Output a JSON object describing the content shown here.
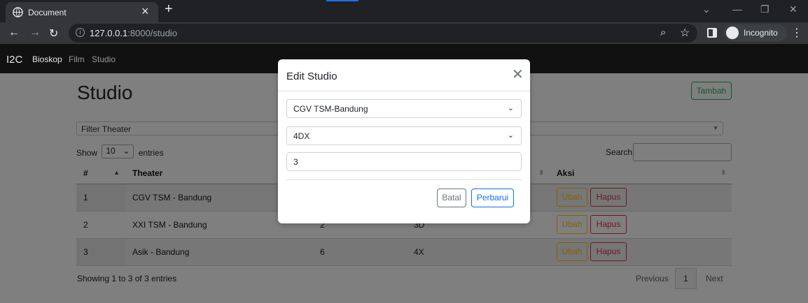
{
  "browser": {
    "tab_title": "Document",
    "url_host": "127.0.0.1",
    "url_path": ":8000/studio",
    "profile_label": "Incognito"
  },
  "navbar": {
    "brand": "I2C",
    "links": [
      {
        "label": "Bioskop",
        "active": true
      },
      {
        "label": "Film",
        "active": false
      },
      {
        "label": "Studio",
        "active": false
      }
    ]
  },
  "page": {
    "title": "Studio",
    "add_button": "Tambah",
    "filter_placeholder": "Filter Theater",
    "length_label_before": "Show",
    "length_value": "10",
    "length_label_after": "entries",
    "search_label": "Search:",
    "table": {
      "headers": [
        "#",
        "Theater",
        "",
        "",
        "Aksi"
      ],
      "rows": [
        {
          "no": "1",
          "theater": "CGV TSM - Bandung",
          "col3": "",
          "col4": ""
        },
        {
          "no": "2",
          "theater": "XXI TSM - Bandung",
          "col3": "2",
          "col4": "3D"
        },
        {
          "no": "3",
          "theater": "Asik - Bandung",
          "col3": "6",
          "col4": "4X"
        }
      ],
      "edit_label": "Ubah",
      "delete_label": "Hapus"
    },
    "info": "Showing 1 to 3 of 3 entries",
    "pagination": {
      "previous": "Previous",
      "current": "1",
      "next": "Next"
    }
  },
  "modal": {
    "title": "Edit Studio",
    "theater_value": "CGV TSM-Bandung",
    "type_value": "4DX",
    "number_value": "3",
    "cancel_label": "Batal",
    "submit_label": "Perbarui"
  },
  "colors": {
    "accent_success": "#198754",
    "accent_primary": "#0d6efd",
    "accent_warning": "#ffc107",
    "accent_danger": "#dc3545"
  }
}
